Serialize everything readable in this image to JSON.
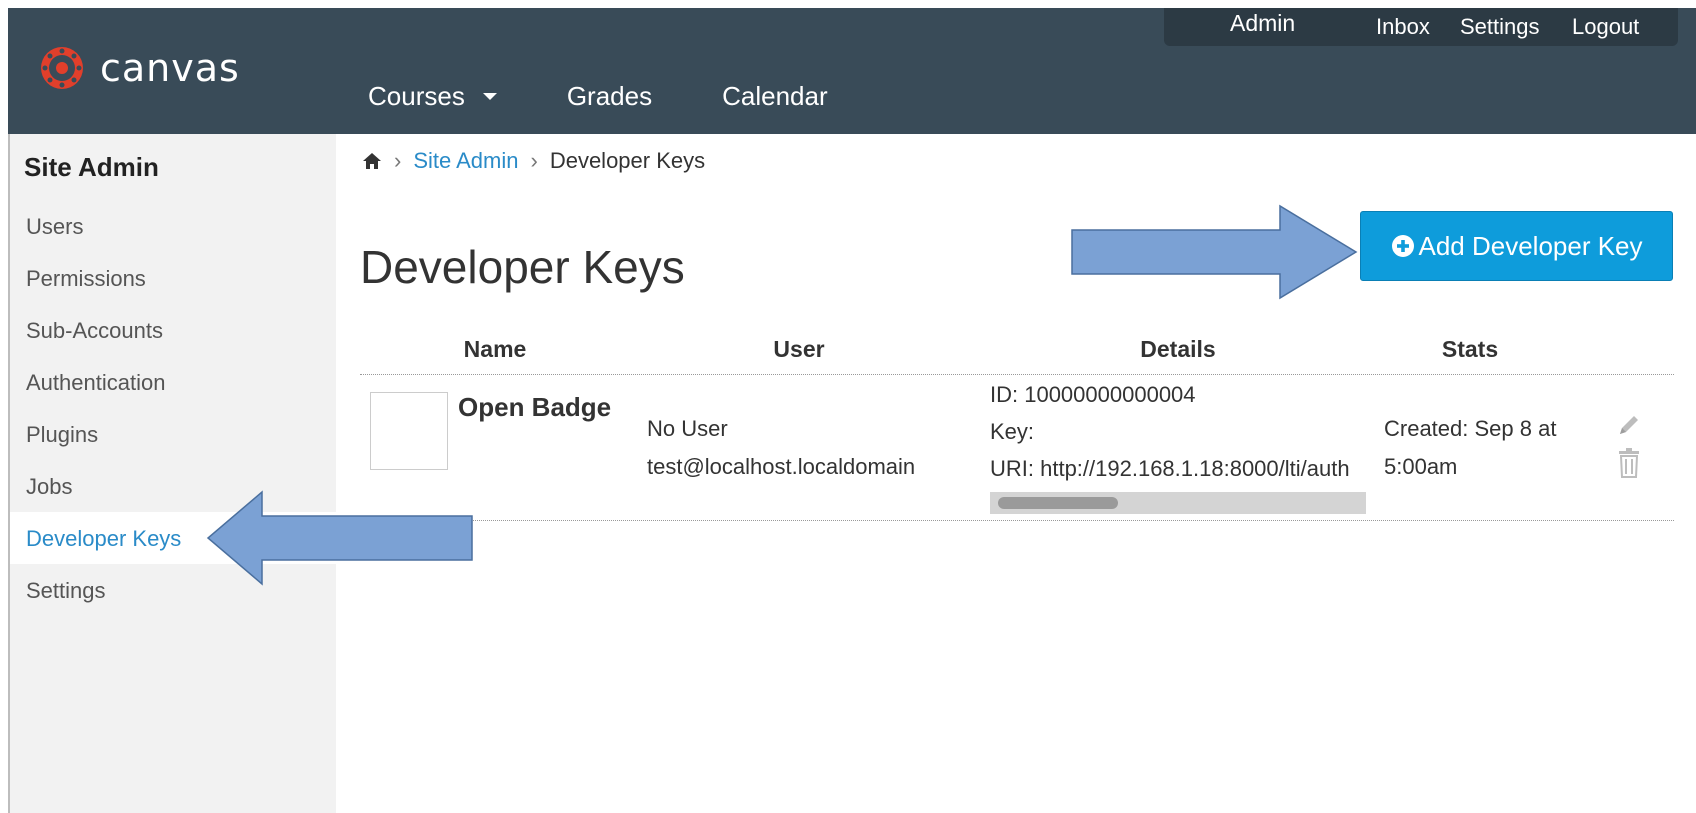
{
  "header": {
    "logo_text": "canvas",
    "main_nav": [
      {
        "label": "Courses"
      },
      {
        "label": "Grades"
      },
      {
        "label": "Calendar"
      }
    ],
    "user_nav": {
      "admin": "Admin",
      "inbox": "Inbox",
      "settings": "Settings",
      "logout": "Logout"
    }
  },
  "sidebar": {
    "title": "Site Admin",
    "items": [
      {
        "label": "Users"
      },
      {
        "label": "Permissions"
      },
      {
        "label": "Sub-Accounts"
      },
      {
        "label": "Authentication"
      },
      {
        "label": "Plugins"
      },
      {
        "label": "Jobs"
      },
      {
        "label": "Developer Keys",
        "active": true
      },
      {
        "label": "Settings"
      }
    ]
  },
  "breadcrumb": {
    "items": [
      "Site Admin",
      "Developer Keys"
    ]
  },
  "page": {
    "title": "Developer Keys",
    "add_button_label": "Add Developer Key"
  },
  "table": {
    "headers": {
      "name": "Name",
      "user": "User",
      "details": "Details",
      "stats": "Stats"
    },
    "rows": [
      {
        "name": "Open Badge",
        "user_name": "No User",
        "user_email": "test@localhost.localdomain",
        "id": "ID: 10000000000004",
        "key": "Key:",
        "uri": "URI: http://192.168.1.18:8000/lti/auth",
        "created_line1": "Created: Sep 8 at",
        "created_line2": "5:00am"
      }
    ]
  },
  "colors": {
    "header_bg": "#394b58",
    "accent": "#2a8bc8",
    "button_bg": "#0e9cdb",
    "annotation_arrow": "#7ba1d4"
  }
}
